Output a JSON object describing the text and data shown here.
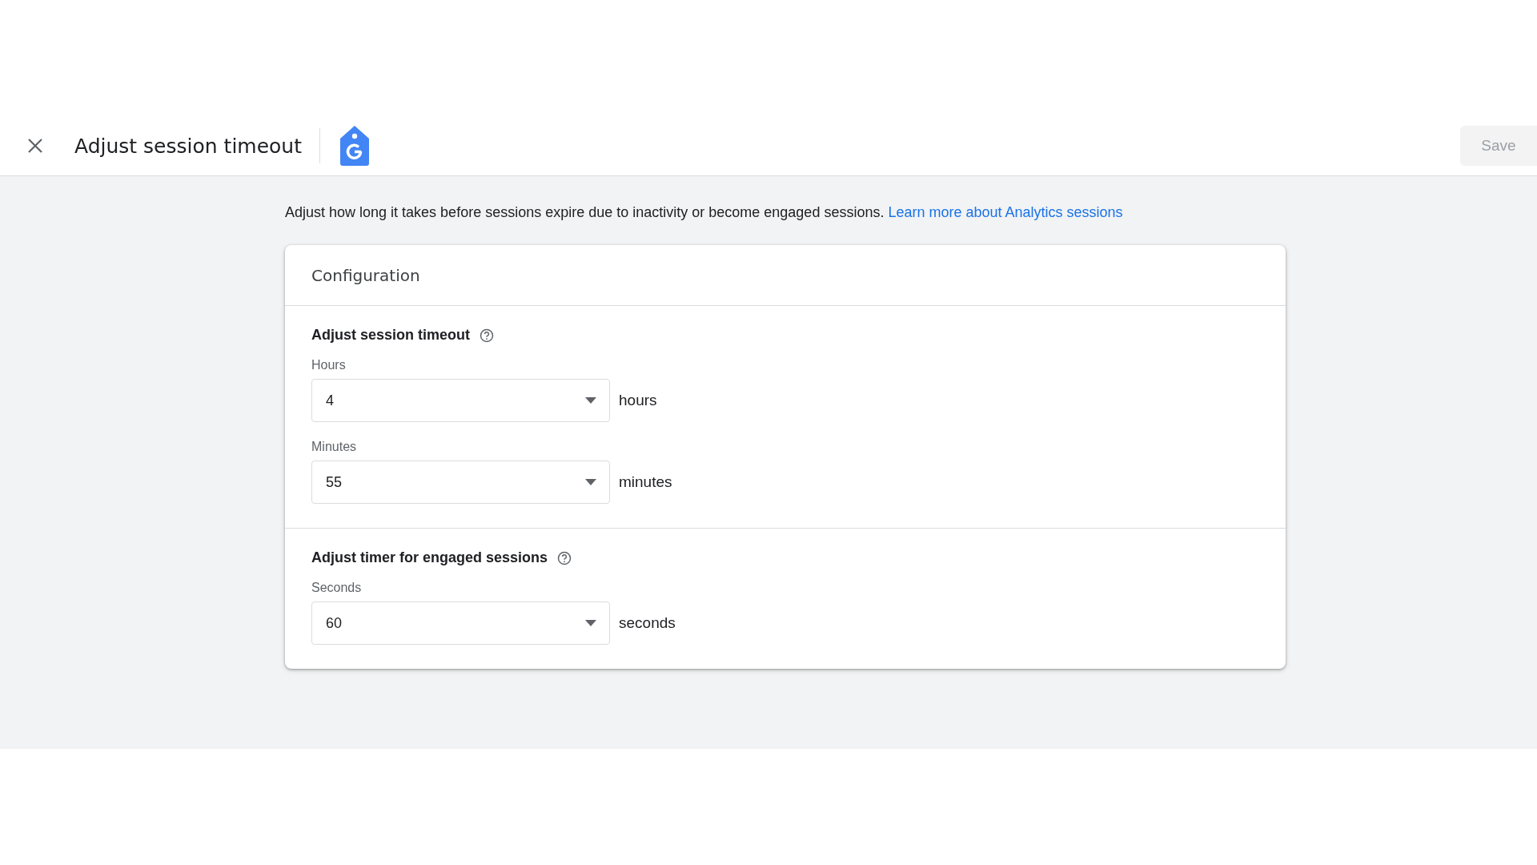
{
  "header": {
    "title": "Adjust session timeout",
    "save_button": {
      "label": "Save",
      "disabled": true
    }
  },
  "description": {
    "text": "Adjust how long it takes before sessions expire due to inactivity or become engaged sessions.",
    "link": "Learn more about Analytics sessions"
  },
  "card": {
    "title": "Configuration",
    "sections": [
      {
        "title": "Adjust session timeout",
        "fields": [
          {
            "label": "Hours",
            "value": "4",
            "unit": "hours"
          },
          {
            "label": "Minutes",
            "value": "55",
            "unit": "minutes"
          }
        ]
      },
      {
        "title": "Adjust timer for engaged sessions",
        "fields": [
          {
            "label": "Seconds",
            "value": "60",
            "unit": "seconds"
          }
        ]
      }
    ]
  }
}
